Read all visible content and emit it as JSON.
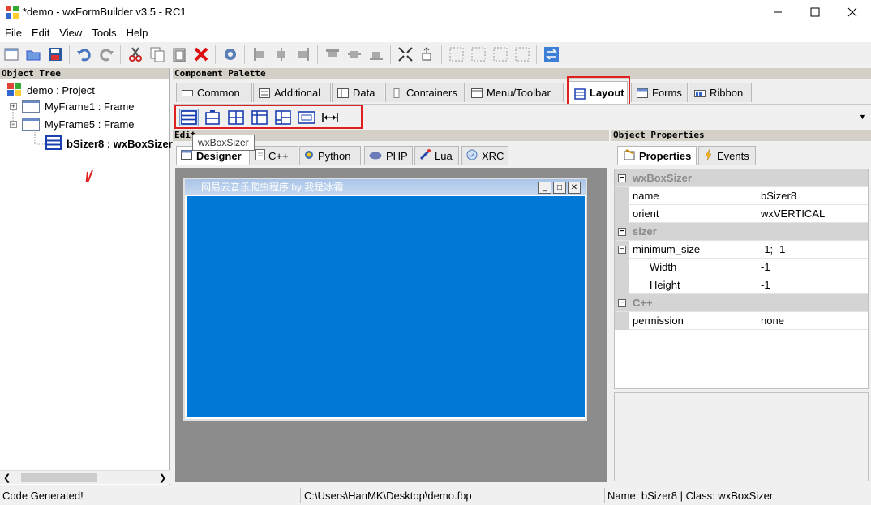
{
  "window": {
    "title": "*demo - wxFormBuilder v3.5 - RC1"
  },
  "menu": [
    "File",
    "Edit",
    "View",
    "Tools",
    "Help"
  ],
  "object_tree": {
    "header": "Object Tree",
    "nodes": [
      {
        "label": "demo : Project"
      },
      {
        "label": "MyFrame1 : Frame"
      },
      {
        "label": "MyFrame5 : Frame"
      },
      {
        "label": "bSizer8 : wxBoxSizer"
      }
    ]
  },
  "palette": {
    "header": "Component Palette",
    "tabs": [
      "Common",
      "Additional",
      "Data",
      "Containers",
      "Menu/Toolbar",
      "Layout",
      "Forms",
      "Ribbon"
    ],
    "active_tab": "Layout",
    "tooltip": "wxBoxSizer"
  },
  "editor": {
    "header": "Edit",
    "tabs": [
      "Designer",
      "C++",
      "Python",
      "PHP",
      "Lua",
      "XRC"
    ],
    "frame_title": "网易云音乐爬虫程序 by 我是冰霜"
  },
  "properties": {
    "header": "Object Properties",
    "tabs": [
      "Properties",
      "Events"
    ],
    "rows": [
      {
        "key": "wxBoxSizer",
        "cat": true
      },
      {
        "key": "name",
        "value": "bSizer8"
      },
      {
        "key": "orient",
        "value": "wxVERTICAL"
      },
      {
        "key": "sizer",
        "cat": true
      },
      {
        "key": "minimum_size",
        "value": "-1; -1"
      },
      {
        "key": "Width",
        "value": "-1"
      },
      {
        "key": "Height",
        "value": "-1"
      },
      {
        "key": "C++",
        "cat": true
      },
      {
        "key": "permission",
        "value": "none"
      }
    ]
  },
  "status": {
    "left": "Code Generated!",
    "path": "C:\\Users\\HanMK\\Desktop\\demo.fbp",
    "info": "Name: bSizer8 | Class: wxBoxSizer"
  },
  "colors": {
    "accent": "#0078d7",
    "highlight_box": "#e02020"
  }
}
